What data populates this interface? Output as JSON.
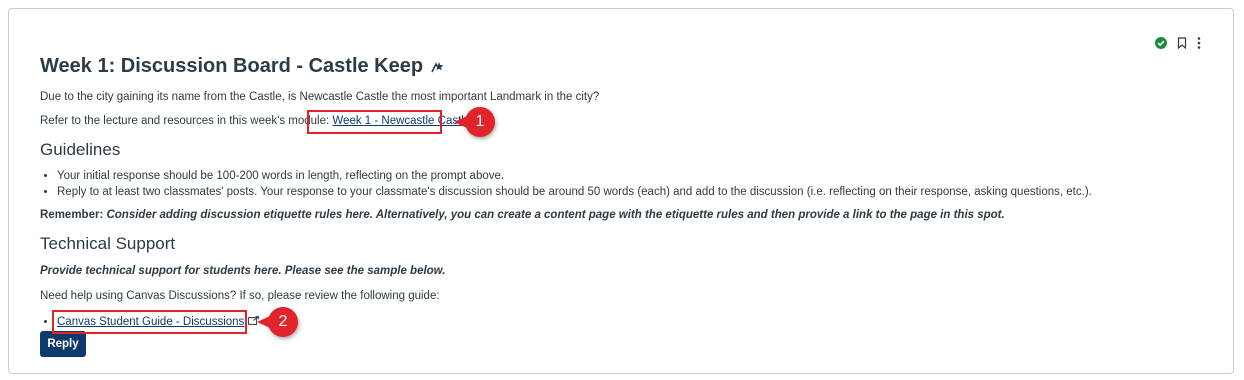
{
  "discussion": {
    "title": "Week 1: Discussion Board - Castle Keep",
    "intro": "Due to the city gaining its name from the Castle, is Newcastle Castle the most important Landmark in the city?",
    "refer_text": "Refer to the lecture and resources in this week's module: ",
    "module_link": "Week 1 - Newcastle Castle.",
    "guidelines_heading": "Guidelines",
    "guidelines": [
      "Your initial response should be 100-200 words in length, reflecting on the prompt above.",
      "Reply to at least two classmates' posts. Your response to your classmate's discussion should be around 50 words (each) and add to the discussion (i.e. reflecting on their response, asking questions, etc.)."
    ],
    "remember_label": "Remember:",
    "remember_text": " Consider adding discussion etiquette rules here. Alternatively, you can create a content page with the etiquette rules and then provide a link to the page in this spot.",
    "tech_heading": "Technical Support",
    "tech_note": "Provide technical support for students here. Please see the sample below.",
    "help_text": "Need help using Canvas Discussions? If so, please review the following guide:",
    "guide_link": "Canvas Student Guide - Discussions",
    "reply_label": "Reply"
  },
  "callouts": {
    "one": "1",
    "two": "2"
  },
  "colors": {
    "link": "#0e3a6b",
    "reply_button": "#0e3a6b",
    "published": "#1c8a3b",
    "callout": "#e0242a"
  },
  "icons": [
    "published-check-icon",
    "bookmark-icon",
    "kebab-menu-icon",
    "speedgrader-icon",
    "external-link-icon"
  ]
}
